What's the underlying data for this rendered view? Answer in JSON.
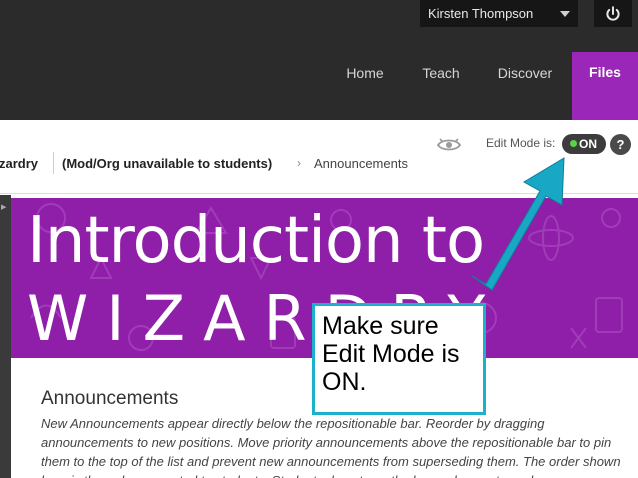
{
  "header": {
    "user_name": "Kirsten Thompson",
    "nav": {
      "home": "Home",
      "teach": "Teach",
      "discover": "Discover",
      "files": "Files"
    }
  },
  "breadcrumb": {
    "course": "zardry",
    "course_status": "(Mod/Org unavailable to students)",
    "page": "Announcements"
  },
  "edit_mode": {
    "label": "Edit Mode is:",
    "state": "ON",
    "help": "?"
  },
  "banner": {
    "line1": "Introduction to",
    "line2": "WIZARDRY"
  },
  "announcements": {
    "title": "Announcements",
    "description": "New Announcements appear directly below the repositionable bar. Reorder by dragging announcements to new positions. Move priority announcements above the repositionable bar to pin them to the top of the list and prevent new announcements from superseding them. The order shown here is the order presented to students. Students do not see the bar and cannot reorder"
  },
  "callout": {
    "text": "Make sure Edit Mode is ON."
  },
  "colors": {
    "topbar": "#2b2b2b",
    "files_tab": "#9b27b8",
    "banner": "#8f1ea8",
    "callout_border": "#1db0cc",
    "toggle_dot": "#5cd14a"
  }
}
